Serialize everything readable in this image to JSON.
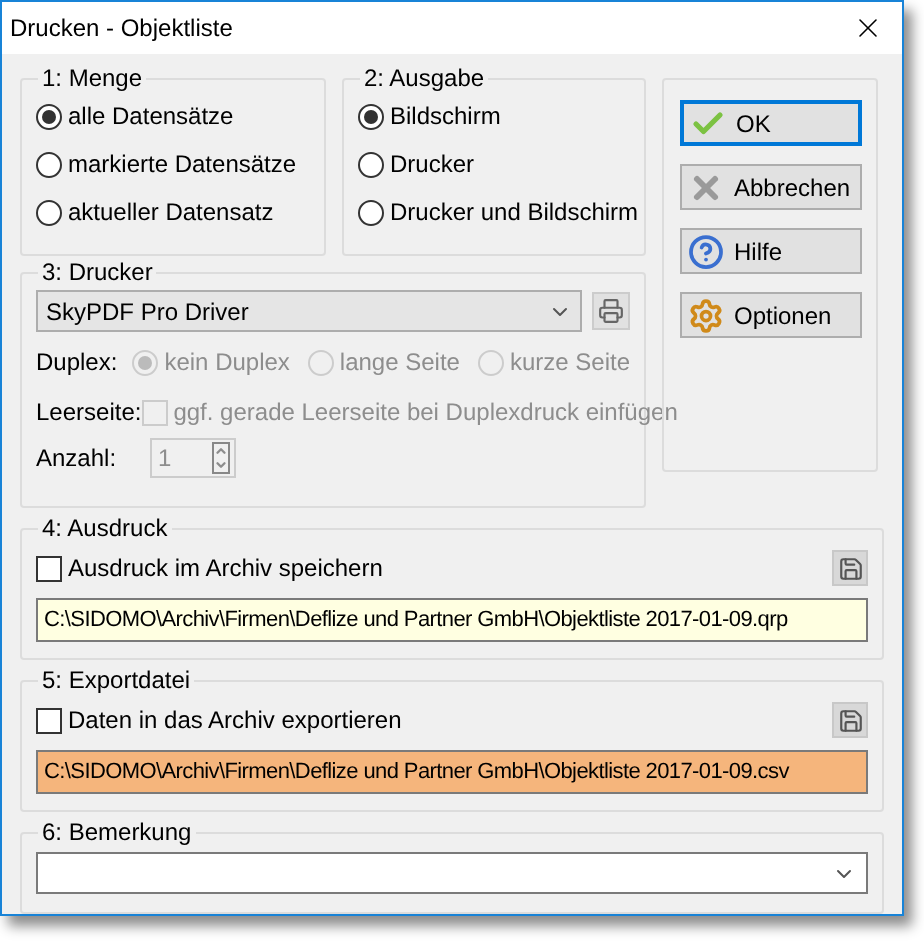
{
  "window": {
    "title": "Drucken - Objektliste"
  },
  "menge": {
    "title": "1: Menge",
    "options": [
      {
        "label": "alle Datensätze",
        "selected": true
      },
      {
        "label": "markierte Datensätze",
        "selected": false
      },
      {
        "label": "aktueller Datensatz",
        "selected": false
      }
    ]
  },
  "ausgabe": {
    "title": "2: Ausgabe",
    "options": [
      {
        "label": "Bildschirm",
        "selected": true
      },
      {
        "label": "Drucker",
        "selected": false
      },
      {
        "label": "Drucker und Bildschirm",
        "selected": false
      }
    ]
  },
  "buttons": [
    {
      "label": "OK",
      "kind": "ok",
      "focused": true
    },
    {
      "label": "Abbrechen",
      "kind": "cancel",
      "focused": false
    },
    {
      "label": "Hilfe",
      "kind": "help",
      "focused": false
    },
    {
      "label": "Optionen",
      "kind": "options",
      "focused": false
    }
  ],
  "drucker": {
    "title": "3: Drucker",
    "printer": "SkyPDF Pro Driver",
    "duplex": {
      "label": "Duplex:",
      "disabled": true,
      "options": [
        {
          "label": "kein Duplex",
          "selected": true
        },
        {
          "label": "lange Seite",
          "selected": false
        },
        {
          "label": "kurze Seite",
          "selected": false
        }
      ]
    },
    "blank_page": {
      "label": "Leerseite:",
      "option": "ggf. gerade Leerseite bei Duplexdruck einfügen",
      "checked": false,
      "disabled": true
    },
    "copies": {
      "label": "Anzahl:",
      "value": "1",
      "disabled": true
    }
  },
  "ausdruck": {
    "title": "4: Ausdruck",
    "checkbox": {
      "label": "Ausdruck im Archiv speichern",
      "checked": false
    },
    "path": {
      "value": "C:\\SIDOMO\\Archiv\\Firmen\\Deflize und Partner GmbH\\Objektliste 2017-01-09.qrp",
      "color": "#ffffe1"
    }
  },
  "export": {
    "title": "5: Exportdatei",
    "checkbox": {
      "label": "Daten in das Archiv exportieren",
      "checked": false
    },
    "path": {
      "value": "C:\\SIDOMO\\Archiv\\Firmen\\Deflize und Partner GmbH\\Objektliste 2017-01-09.csv",
      "color": "#f5b57c"
    }
  },
  "bemerkung": {
    "title": "6: Bemerkung"
  }
}
